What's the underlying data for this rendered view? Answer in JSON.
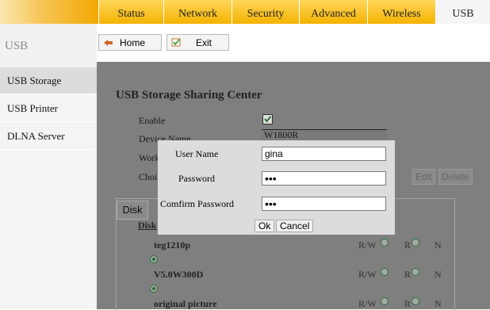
{
  "tabs": [
    "Status",
    "Network",
    "Security",
    "Advanced",
    "Wireless",
    "USB"
  ],
  "active_tab": "USB",
  "sidebar": {
    "title": "USB",
    "items": [
      {
        "label": "USB Storage",
        "active": true
      },
      {
        "label": "USB Printer",
        "active": false
      },
      {
        "label": "DLNA Server",
        "active": false
      }
    ]
  },
  "toolbar": {
    "home_label": "Home",
    "exit_label": "Exit"
  },
  "main": {
    "heading": "USB Storage Sharing Center",
    "enable_label": "Enable",
    "enable_checked": true,
    "device_name_label": "Device Name",
    "device_name_value": "W1800R",
    "workgroup_label": "Work",
    "choice_label": "Choi",
    "edit_label": "Edit",
    "delete_label": "Delete",
    "disk_tab": "Disk",
    "disk_header": "Disk",
    "disks": [
      {
        "name": "teg1210p",
        "rw": "R/W",
        "r": "R",
        "n": "N",
        "selected": "N"
      },
      {
        "name": "V5.0W300D",
        "rw": "R/W",
        "r": "R",
        "n": "N",
        "selected": "N"
      },
      {
        "name": "original picture",
        "rw": "R/W",
        "r": "R",
        "n": "N",
        "selected": "N"
      }
    ]
  },
  "dialog": {
    "user_name_label": "User Name",
    "user_name_value": "gina",
    "password_label": "Password",
    "password_value": "•••",
    "confirm_label": "Comfirm Password",
    "confirm_value": "•••",
    "ok_label": "Ok",
    "cancel_label": "Cancel"
  },
  "colors": {
    "tab_bar": "#f5b400",
    "overlay": "#7f7f7f",
    "dialog_bg": "#dcdcdc"
  }
}
